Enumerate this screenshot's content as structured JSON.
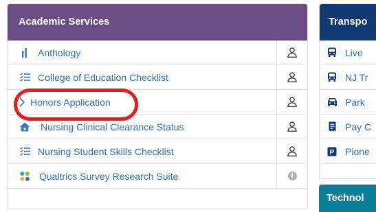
{
  "academic": {
    "title": "Academic Services",
    "items": [
      {
        "label": "Anthology",
        "icon": "bar-chart-icon",
        "action": "person-icon"
      },
      {
        "label": "College of Education Checklist",
        "icon": "checklist-icon",
        "action": "person-icon"
      },
      {
        "label": "Honors Application",
        "icon": "chevron-right-icon",
        "action": "person-icon"
      },
      {
        "label": "Nursing Clinical Clearance Status",
        "icon": "home-icon",
        "action": "person-icon"
      },
      {
        "label": "Nursing Student Skills Checklist",
        "icon": "checklist-icon",
        "action": "person-icon"
      },
      {
        "label": "Qualtrics Survey Research Suite",
        "icon": "grid-dots-icon",
        "action": "info-icon"
      }
    ]
  },
  "transport": {
    "title": "Transpo",
    "items": [
      {
        "label": "Live",
        "icon": "bus-icon"
      },
      {
        "label": "NJ Tr",
        "icon": "bus-icon"
      },
      {
        "label": "Park",
        "icon": "car-icon"
      },
      {
        "label": "Pay C",
        "icon": "receipt-icon"
      },
      {
        "label": "Pione",
        "icon": "parking-icon"
      }
    ]
  },
  "technology": {
    "title": "Technol"
  },
  "colors": {
    "academic_header": "#6b4e84",
    "transport_header": "#123a72",
    "technology_header": "#0b7e97",
    "link": "#2f6fb5",
    "highlight": "#e02020"
  }
}
